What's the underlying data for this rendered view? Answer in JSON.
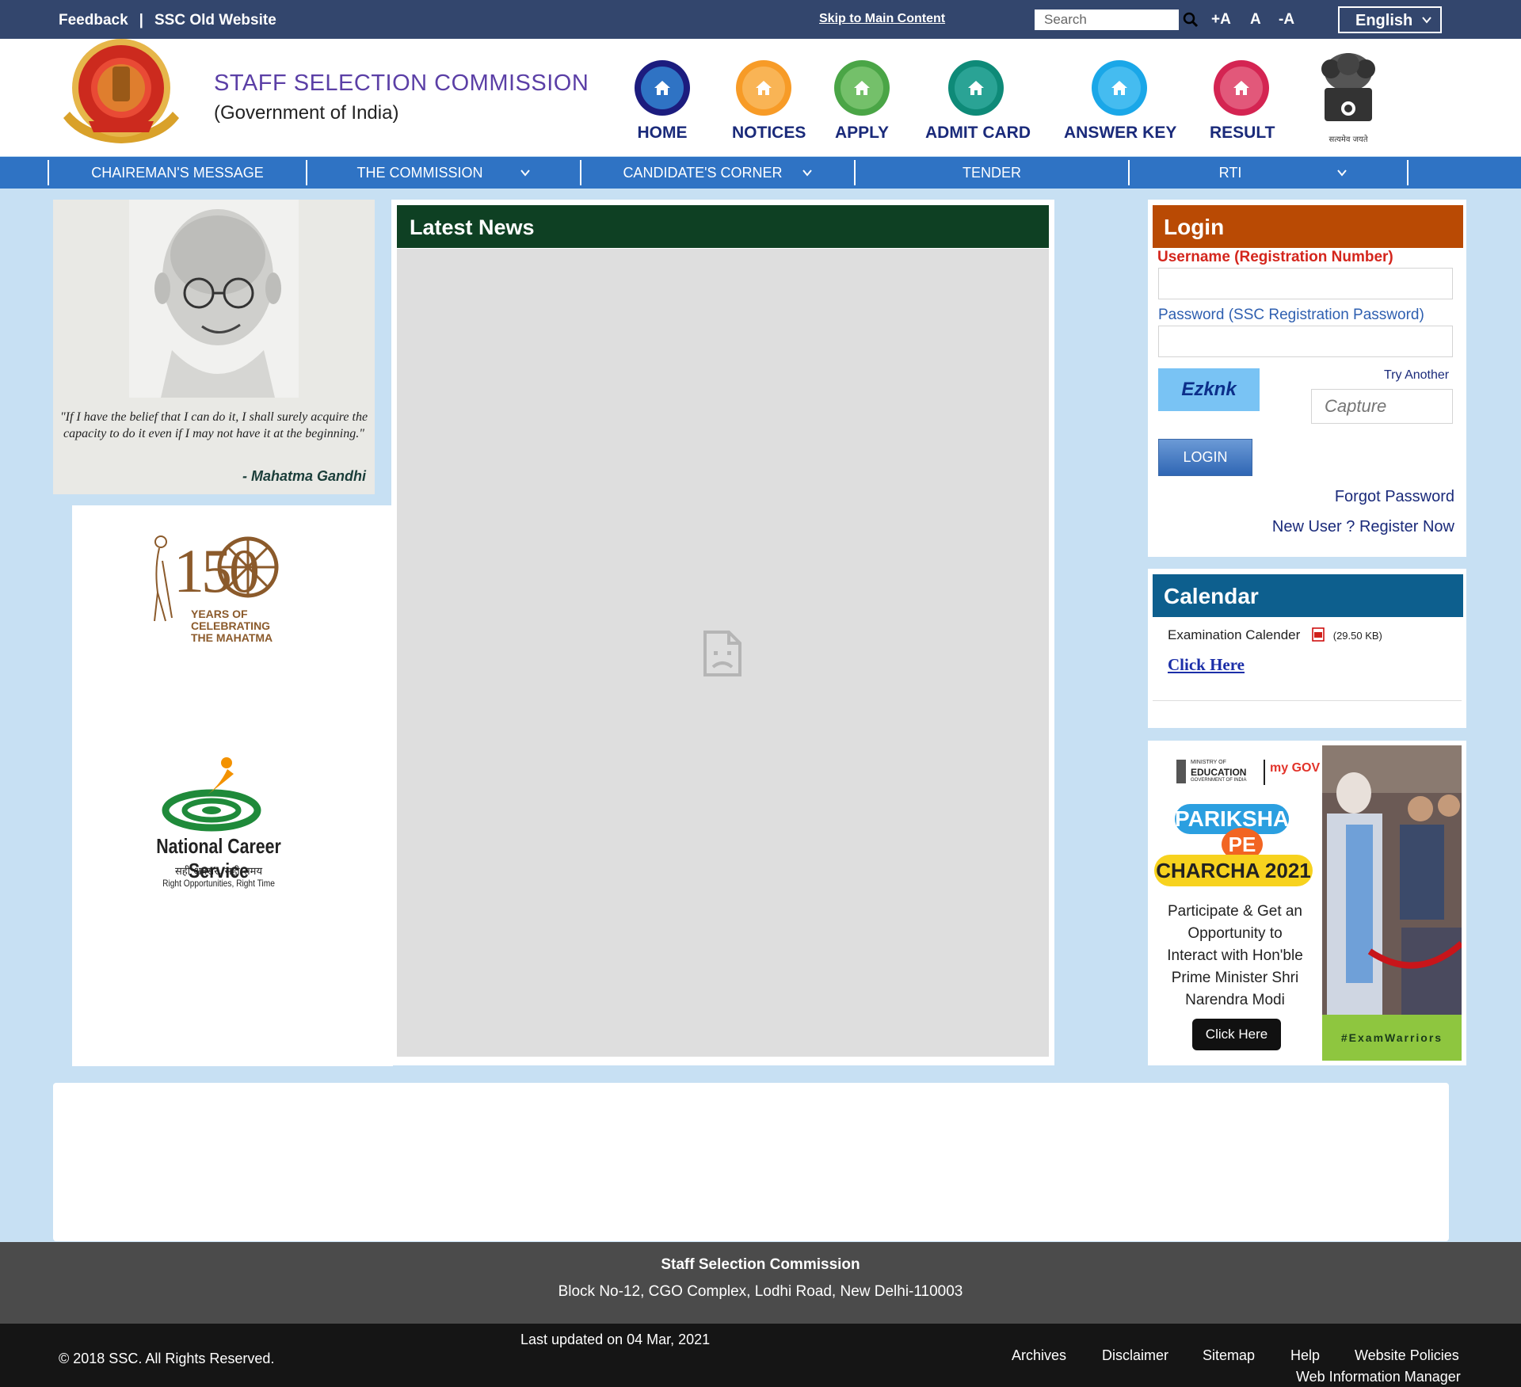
{
  "topbar": {
    "feedback": "Feedback",
    "divider": "|",
    "old_website": "SSC Old Website",
    "skip": "Skip to Main Content",
    "search_placeholder": "Search",
    "font_increase": "+A",
    "font_normal": "A",
    "font_decrease": "-A",
    "language": "English"
  },
  "header": {
    "title": "STAFF SELECTION COMMISSION",
    "subtitle": "(Government of India)",
    "nav_icons": [
      {
        "label": "HOME",
        "ring": "#1c1c7e",
        "fill": "#2f73c4"
      },
      {
        "label": "NOTICES",
        "ring": "#f79b27",
        "fill": "#f4a53a"
      },
      {
        "label": "APPLY",
        "ring": "#4aa546",
        "fill": "#6cbd5e"
      },
      {
        "label": "ADMIT CARD",
        "ring": "#0e8a78",
        "fill": "#2aa395"
      },
      {
        "label": "ANSWER KEY",
        "ring": "#1aa7e8",
        "fill": "#3cb8ef"
      },
      {
        "label": "RESULT",
        "ring": "#d42452",
        "fill": "#e2587a"
      }
    ],
    "emblem_caption": "सत्यमेव जयते"
  },
  "mainnav": {
    "items": [
      {
        "label": "CHAIREMAN'S MESSAGE",
        "dropdown": false
      },
      {
        "label": "THE COMMISSION",
        "dropdown": true
      },
      {
        "label": "CANDIDATE'S CORNER",
        "dropdown": true
      },
      {
        "label": "TENDER",
        "dropdown": false
      },
      {
        "label": "RTI",
        "dropdown": true
      }
    ]
  },
  "left": {
    "quote": "\"If I have the belief that I can do it, I shall surely acquire the capacity to do it even if I may not have it at the beginning.\"",
    "quote_author": "- Mahatma Gandhi",
    "banner_150_number": "150",
    "banner_150_line1": "YEARS OF",
    "banner_150_line2": "CELEBRATING",
    "banner_150_line3": "THE MAHATMA",
    "ncs_title": "National Career Service",
    "ncs_hindi": "सही अवसर, सही समय",
    "ncs_tagline": "Right Opportunities, Right Time"
  },
  "news": {
    "heading": "Latest News"
  },
  "login": {
    "heading": "Login",
    "username_label": "Username (Registration Number)",
    "password_label": "Password (SSC Registration Password)",
    "captcha_text": "Ezknk",
    "try_another": "Try Another",
    "captcha_placeholder": "Capture",
    "login_button": "LOGIN",
    "forgot": "Forgot Password",
    "register": "New User ? Register Now"
  },
  "calendar": {
    "heading": "Calendar",
    "item": "Examination Calender",
    "size": "(29.50 KB)",
    "link": "Click Here"
  },
  "promo": {
    "ministry_small": "MINISTRY OF",
    "ministry": "EDUCATION",
    "ministry_sub": "GOVERNMENT OF INDIA",
    "mygov": "my GOV",
    "title1": "PARIKSHA",
    "title2": "PE",
    "title3": "CHARCHA 2021",
    "body": "Participate & Get an Opportunity to Interact with Hon'ble Prime Minister Shri Narendra Modi",
    "button": "Click Here",
    "tag": "#ExamWarriors"
  },
  "footer": {
    "org": "Staff Selection Commission",
    "address": "Block No-12, CGO Complex, Lodhi Road, New Delhi-110003",
    "copyright": "© 2018 SSC. All Rights Reserved.",
    "updated": "Last updated on 04 Mar, 2021",
    "links": [
      "Archives",
      "Disclaimer",
      "Sitemap",
      "Help",
      "Website Policies"
    ],
    "wim": "Web Information Manager"
  },
  "colors": {
    "topbar": "#33466d",
    "nav": "#2f73c4",
    "news_header": "#0e4023",
    "login_header": "#b94a04",
    "calendar_header": "#0d5f8e",
    "background": "#c7e0f3"
  }
}
